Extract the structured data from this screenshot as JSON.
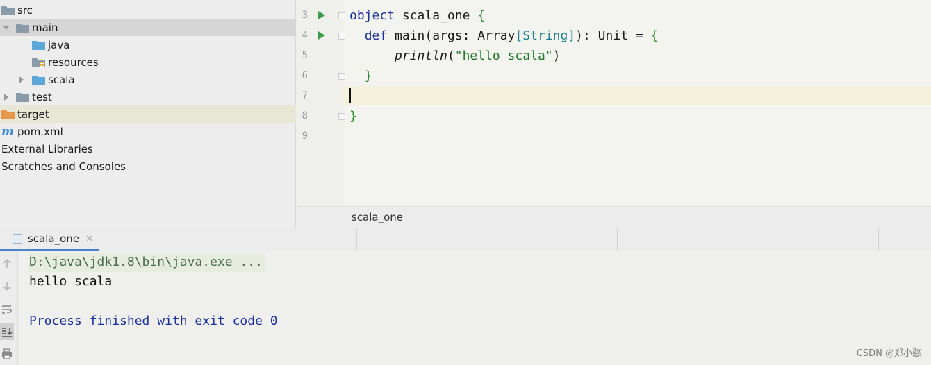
{
  "project_tree": {
    "items": [
      {
        "label": "src"
      },
      {
        "label": "main"
      },
      {
        "label": "java"
      },
      {
        "label": "resources"
      },
      {
        "label": "scala"
      },
      {
        "label": "test"
      },
      {
        "label": "target"
      },
      {
        "label": "pom.xml",
        "icon_text": "m"
      },
      {
        "label": "External Libraries"
      },
      {
        "label": "Scratches and Consoles"
      }
    ]
  },
  "editor": {
    "line_numbers": [
      "3",
      "4",
      "5",
      "6",
      "7",
      "8",
      "9"
    ],
    "lines": {
      "l3": {
        "kw": "object",
        "name": " scala_one ",
        "brace": "{"
      },
      "l4": {
        "indent": "  ",
        "kw": "def",
        "sig1": " main(args: Array",
        "lb": "[",
        "type": "String",
        "rb": "]",
        "sig2": "): Unit = ",
        "brace": "{"
      },
      "l5": {
        "indent": "      ",
        "fn": "println",
        "open": "(",
        "str": "\"hello scala\"",
        "close": ")"
      },
      "l6": {
        "indent": "  ",
        "brace": "}"
      },
      "l8": {
        "brace": "}"
      }
    }
  },
  "breadcrumb": {
    "label": "scala_one"
  },
  "run_panel": {
    "tab_label": "scala_one",
    "tab_close": "×",
    "console": {
      "command": "D:\\java\\jdk1.8\\bin\\java.exe ...",
      "output": "hello scala",
      "exit": "Process finished with exit code 0"
    }
  },
  "watermark": "CSDN @郑小憨",
  "colors": {
    "keyword": "#1c2f9f",
    "string": "#1e7a22",
    "type": "#18808c",
    "run_icon": "#3d9a4d",
    "folder": "#8a9aa8",
    "source_folder": "#5ba8d8",
    "excluded_folder": "#e9974a",
    "tab_underline": "#4a83c9"
  }
}
